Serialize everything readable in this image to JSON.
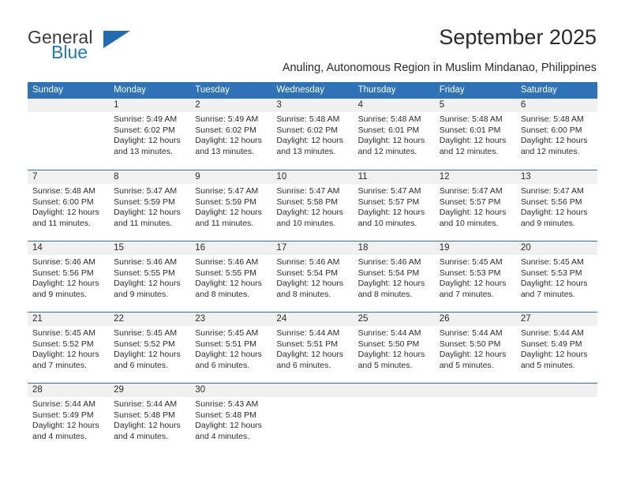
{
  "brand": {
    "name_top": "General",
    "name_bottom": "Blue",
    "accent_color": "#1f6cb4"
  },
  "header": {
    "title": "September 2025",
    "subtitle": "Anuling, Autonomous Region in Muslim Mindanao, Philippines"
  },
  "theme": {
    "header_blue": "#2e72b8",
    "number_band": "#f0f0f0",
    "text": "#2c2c2c"
  },
  "calendar": {
    "weekdays": [
      "Sunday",
      "Monday",
      "Tuesday",
      "Wednesday",
      "Thursday",
      "Friday",
      "Saturday"
    ],
    "weeks": [
      [
        {
          "day": "",
          "sunrise": "",
          "sunset": "",
          "daylight_line1": "",
          "daylight_line2": ""
        },
        {
          "day": "1",
          "sunrise": "Sunrise: 5:49 AM",
          "sunset": "Sunset: 6:02 PM",
          "daylight_line1": "Daylight: 12 hours",
          "daylight_line2": "and 13 minutes."
        },
        {
          "day": "2",
          "sunrise": "Sunrise: 5:49 AM",
          "sunset": "Sunset: 6:02 PM",
          "daylight_line1": "Daylight: 12 hours",
          "daylight_line2": "and 13 minutes."
        },
        {
          "day": "3",
          "sunrise": "Sunrise: 5:48 AM",
          "sunset": "Sunset: 6:02 PM",
          "daylight_line1": "Daylight: 12 hours",
          "daylight_line2": "and 13 minutes."
        },
        {
          "day": "4",
          "sunrise": "Sunrise: 5:48 AM",
          "sunset": "Sunset: 6:01 PM",
          "daylight_line1": "Daylight: 12 hours",
          "daylight_line2": "and 12 minutes."
        },
        {
          "day": "5",
          "sunrise": "Sunrise: 5:48 AM",
          "sunset": "Sunset: 6:01 PM",
          "daylight_line1": "Daylight: 12 hours",
          "daylight_line2": "and 12 minutes."
        },
        {
          "day": "6",
          "sunrise": "Sunrise: 5:48 AM",
          "sunset": "Sunset: 6:00 PM",
          "daylight_line1": "Daylight: 12 hours",
          "daylight_line2": "and 12 minutes."
        }
      ],
      [
        {
          "day": "7",
          "sunrise": "Sunrise: 5:48 AM",
          "sunset": "Sunset: 6:00 PM",
          "daylight_line1": "Daylight: 12 hours",
          "daylight_line2": "and 11 minutes."
        },
        {
          "day": "8",
          "sunrise": "Sunrise: 5:47 AM",
          "sunset": "Sunset: 5:59 PM",
          "daylight_line1": "Daylight: 12 hours",
          "daylight_line2": "and 11 minutes."
        },
        {
          "day": "9",
          "sunrise": "Sunrise: 5:47 AM",
          "sunset": "Sunset: 5:59 PM",
          "daylight_line1": "Daylight: 12 hours",
          "daylight_line2": "and 11 minutes."
        },
        {
          "day": "10",
          "sunrise": "Sunrise: 5:47 AM",
          "sunset": "Sunset: 5:58 PM",
          "daylight_line1": "Daylight: 12 hours",
          "daylight_line2": "and 10 minutes."
        },
        {
          "day": "11",
          "sunrise": "Sunrise: 5:47 AM",
          "sunset": "Sunset: 5:57 PM",
          "daylight_line1": "Daylight: 12 hours",
          "daylight_line2": "and 10 minutes."
        },
        {
          "day": "12",
          "sunrise": "Sunrise: 5:47 AM",
          "sunset": "Sunset: 5:57 PM",
          "daylight_line1": "Daylight: 12 hours",
          "daylight_line2": "and 10 minutes."
        },
        {
          "day": "13",
          "sunrise": "Sunrise: 5:47 AM",
          "sunset": "Sunset: 5:56 PM",
          "daylight_line1": "Daylight: 12 hours",
          "daylight_line2": "and 9 minutes."
        }
      ],
      [
        {
          "day": "14",
          "sunrise": "Sunrise: 5:46 AM",
          "sunset": "Sunset: 5:56 PM",
          "daylight_line1": "Daylight: 12 hours",
          "daylight_line2": "and 9 minutes."
        },
        {
          "day": "15",
          "sunrise": "Sunrise: 5:46 AM",
          "sunset": "Sunset: 5:55 PM",
          "daylight_line1": "Daylight: 12 hours",
          "daylight_line2": "and 9 minutes."
        },
        {
          "day": "16",
          "sunrise": "Sunrise: 5:46 AM",
          "sunset": "Sunset: 5:55 PM",
          "daylight_line1": "Daylight: 12 hours",
          "daylight_line2": "and 8 minutes."
        },
        {
          "day": "17",
          "sunrise": "Sunrise: 5:46 AM",
          "sunset": "Sunset: 5:54 PM",
          "daylight_line1": "Daylight: 12 hours",
          "daylight_line2": "and 8 minutes."
        },
        {
          "day": "18",
          "sunrise": "Sunrise: 5:46 AM",
          "sunset": "Sunset: 5:54 PM",
          "daylight_line1": "Daylight: 12 hours",
          "daylight_line2": "and 8 minutes."
        },
        {
          "day": "19",
          "sunrise": "Sunrise: 5:45 AM",
          "sunset": "Sunset: 5:53 PM",
          "daylight_line1": "Daylight: 12 hours",
          "daylight_line2": "and 7 minutes."
        },
        {
          "day": "20",
          "sunrise": "Sunrise: 5:45 AM",
          "sunset": "Sunset: 5:53 PM",
          "daylight_line1": "Daylight: 12 hours",
          "daylight_line2": "and 7 minutes."
        }
      ],
      [
        {
          "day": "21",
          "sunrise": "Sunrise: 5:45 AM",
          "sunset": "Sunset: 5:52 PM",
          "daylight_line1": "Daylight: 12 hours",
          "daylight_line2": "and 7 minutes."
        },
        {
          "day": "22",
          "sunrise": "Sunrise: 5:45 AM",
          "sunset": "Sunset: 5:52 PM",
          "daylight_line1": "Daylight: 12 hours",
          "daylight_line2": "and 6 minutes."
        },
        {
          "day": "23",
          "sunrise": "Sunrise: 5:45 AM",
          "sunset": "Sunset: 5:51 PM",
          "daylight_line1": "Daylight: 12 hours",
          "daylight_line2": "and 6 minutes."
        },
        {
          "day": "24",
          "sunrise": "Sunrise: 5:44 AM",
          "sunset": "Sunset: 5:51 PM",
          "daylight_line1": "Daylight: 12 hours",
          "daylight_line2": "and 6 minutes."
        },
        {
          "day": "25",
          "sunrise": "Sunrise: 5:44 AM",
          "sunset": "Sunset: 5:50 PM",
          "daylight_line1": "Daylight: 12 hours",
          "daylight_line2": "and 5 minutes."
        },
        {
          "day": "26",
          "sunrise": "Sunrise: 5:44 AM",
          "sunset": "Sunset: 5:50 PM",
          "daylight_line1": "Daylight: 12 hours",
          "daylight_line2": "and 5 minutes."
        },
        {
          "day": "27",
          "sunrise": "Sunrise: 5:44 AM",
          "sunset": "Sunset: 5:49 PM",
          "daylight_line1": "Daylight: 12 hours",
          "daylight_line2": "and 5 minutes."
        }
      ],
      [
        {
          "day": "28",
          "sunrise": "Sunrise: 5:44 AM",
          "sunset": "Sunset: 5:49 PM",
          "daylight_line1": "Daylight: 12 hours",
          "daylight_line2": "and 4 minutes."
        },
        {
          "day": "29",
          "sunrise": "Sunrise: 5:44 AM",
          "sunset": "Sunset: 5:48 PM",
          "daylight_line1": "Daylight: 12 hours",
          "daylight_line2": "and 4 minutes."
        },
        {
          "day": "30",
          "sunrise": "Sunrise: 5:43 AM",
          "sunset": "Sunset: 5:48 PM",
          "daylight_line1": "Daylight: 12 hours",
          "daylight_line2": "and 4 minutes."
        },
        {
          "day": "",
          "sunrise": "",
          "sunset": "",
          "daylight_line1": "",
          "daylight_line2": ""
        },
        {
          "day": "",
          "sunrise": "",
          "sunset": "",
          "daylight_line1": "",
          "daylight_line2": ""
        },
        {
          "day": "",
          "sunrise": "",
          "sunset": "",
          "daylight_line1": "",
          "daylight_line2": ""
        },
        {
          "day": "",
          "sunrise": "",
          "sunset": "",
          "daylight_line1": "",
          "daylight_line2": ""
        }
      ]
    ]
  }
}
